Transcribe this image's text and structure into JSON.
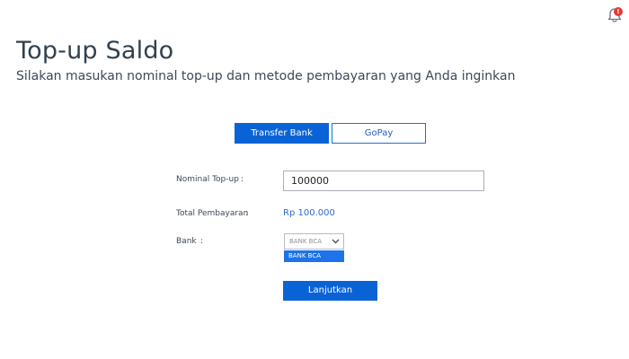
{
  "header": {
    "title": "Top-up Saldo",
    "subtitle": "Silakan masukan nominal top-up dan metode pembayaran yang Anda inginkan"
  },
  "notification": {
    "icon": "bell-icon",
    "badge": "!"
  },
  "payment_tabs": {
    "transfer_label": "Transfer Bank",
    "gopay_label": "GoPay",
    "active": "Transfer Bank"
  },
  "form": {
    "nominal_label": "Nominal Top-up",
    "nominal_value": "100000",
    "total_label": "Total Pembayaran",
    "total_value": "Rp 100.000",
    "bank_label": "Bank",
    "colon": ":",
    "bank_selected": "BANK BCA",
    "bank_options": [
      "BANK BCA"
    ],
    "submit_label": "Lanjutkan"
  },
  "colors": {
    "primary": "#0a63d6",
    "option_highlight": "#1e73e8",
    "total_text": "#2e6ad1",
    "badge": "#e53935"
  }
}
